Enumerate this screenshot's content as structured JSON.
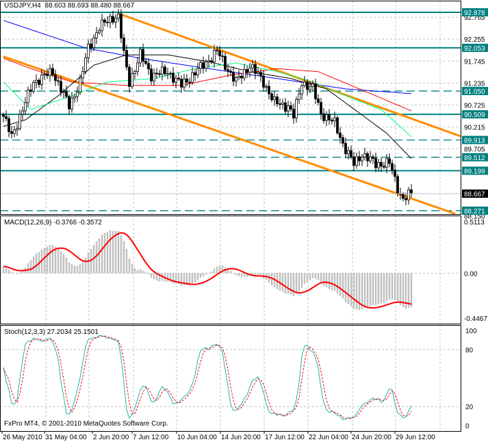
{
  "header": {
    "symbol": "USDJPY,H4",
    "ohlc": "88.603 88.693 88.480 88.667"
  },
  "colors": {
    "teal": "#008080",
    "orange": "#ff8c00",
    "grid": "#c0c0c0",
    "ma_blue": "#0000ff",
    "ma_red": "#ff0000",
    "ma_black": "#000000",
    "ma_green": "#00ff7f",
    "macd_hist": "#c0c0c0",
    "macd_signal": "#ff0000",
    "stoch_main": "#20b2aa",
    "stoch_signal": "#ff0000"
  },
  "price_axis": {
    "ticks": [
      "92.765",
      "92.255",
      "91.745",
      "91.235",
      "90.725",
      "90.215",
      "89.705",
      "88.150"
    ],
    "levels": [
      {
        "label": "92.878",
        "style": "solid"
      },
      {
        "label": "92.053",
        "style": "solid"
      },
      {
        "label": "91.050",
        "style": "dashed"
      },
      {
        "label": "90.509",
        "style": "solid"
      },
      {
        "label": "89.913",
        "style": "dashed"
      },
      {
        "label": "89.512",
        "style": "dashed"
      },
      {
        "label": "89.199",
        "style": "solid"
      },
      {
        "label": "88.271",
        "style": "dashed"
      }
    ],
    "current": "88.667"
  },
  "macd": {
    "title": "MACD(12,26,9) -0.3766 -0.3572",
    "max_label": "0.5113",
    "zero_label": "0.00",
    "min_label": "-0.4467",
    "max": 0.5113,
    "min": -0.4467
  },
  "stoch": {
    "title": "Stoch(12,3,3) 27.2034 25.1501",
    "ticks": [
      "100",
      "80",
      "20",
      "0"
    ]
  },
  "copyright": "FxPro MT4, © 2001-2010 MetaQuotes Software Corp.",
  "time_axis": [
    "26 May 2010",
    "31 May 04:00",
    "2 Jun 20:00",
    "7 Jun 12:00",
    "10 Jun 04:00",
    "14 Jun 20:00",
    "17 Jun 12:00",
    "22 Jun 04:00",
    "24 Jun 20:00",
    "29 Jun 12:00"
  ],
  "chart_data": {
    "type": "candlestick",
    "symbol": "USDJPY",
    "timeframe": "H4",
    "price_range": [
      88.15,
      92.95
    ],
    "close_keypoints": [
      [
        0,
        90.46
      ],
      [
        3,
        89.99
      ],
      [
        8,
        90.78
      ],
      [
        11,
        91.26
      ],
      [
        18,
        91.5
      ],
      [
        24,
        90.7
      ],
      [
        28,
        91.26
      ],
      [
        31,
        92.05
      ],
      [
        35,
        92.53
      ],
      [
        40,
        92.77
      ],
      [
        42,
        92.77
      ],
      [
        44,
        91.89
      ],
      [
        46,
        91.26
      ],
      [
        50,
        91.89
      ],
      [
        54,
        91.42
      ],
      [
        60,
        91.5
      ],
      [
        65,
        91.18
      ],
      [
        69,
        91.42
      ],
      [
        73,
        91.65
      ],
      [
        78,
        91.97
      ],
      [
        81,
        91.65
      ],
      [
        85,
        91.26
      ],
      [
        90,
        91.65
      ],
      [
        95,
        91.26
      ],
      [
        99,
        90.78
      ],
      [
        104,
        90.7
      ],
      [
        106,
        90.46
      ],
      [
        109,
        91.26
      ],
      [
        113,
        91.1
      ],
      [
        116,
        90.54
      ],
      [
        121,
        90.3
      ],
      [
        124,
        89.83
      ],
      [
        128,
        89.35
      ],
      [
        131,
        89.59
      ],
      [
        136,
        89.35
      ],
      [
        141,
        89.38
      ],
      [
        144,
        88.79
      ],
      [
        146,
        88.55
      ],
      [
        149,
        88.667
      ]
    ],
    "moving_averages": [
      {
        "color": "#0000ff",
        "points": [
          [
            0,
            92.69
          ],
          [
            15,
            92.37
          ],
          [
            30,
            92.05
          ],
          [
            50,
            91.81
          ],
          [
            75,
            91.57
          ],
          [
            100,
            91.34
          ],
          [
            125,
            91.1
          ],
          [
            149,
            90.99
          ]
        ]
      },
      {
        "color": "#ff0000",
        "points": [
          [
            0,
            91.81
          ],
          [
            10,
            91.57
          ],
          [
            25,
            91.26
          ],
          [
            45,
            91.18
          ],
          [
            65,
            91.18
          ],
          [
            83,
            91.42
          ],
          [
            100,
            91.57
          ],
          [
            115,
            91.5
          ],
          [
            130,
            91.1
          ],
          [
            149,
            90.59
          ]
        ]
      },
      {
        "color": "#000000",
        "points": [
          [
            0,
            90.23
          ],
          [
            8,
            90.38
          ],
          [
            20,
            90.94
          ],
          [
            33,
            91.65
          ],
          [
            45,
            91.89
          ],
          [
            60,
            91.89
          ],
          [
            75,
            91.73
          ],
          [
            90,
            91.5
          ],
          [
            105,
            91.34
          ],
          [
            118,
            91.1
          ],
          [
            130,
            90.54
          ],
          [
            140,
            90.07
          ],
          [
            149,
            89.48
          ]
        ]
      },
      {
        "color": "#00ff7f",
        "points": [
          [
            0,
            91.26
          ],
          [
            10,
            90.62
          ],
          [
            25,
            90.94
          ],
          [
            38,
            91.26
          ],
          [
            55,
            91.34
          ],
          [
            70,
            91.57
          ],
          [
            85,
            91.7
          ],
          [
            100,
            91.5
          ],
          [
            113,
            91.26
          ],
          [
            125,
            90.94
          ],
          [
            138,
            90.62
          ],
          [
            149,
            89.99
          ]
        ]
      }
    ],
    "channel": {
      "upper": [
        [
          42,
          92.85
        ],
        [
          167,
          90.0
        ]
      ],
      "lower": [
        [
          0,
          91.85
        ],
        [
          165,
          88.2
        ]
      ]
    }
  }
}
